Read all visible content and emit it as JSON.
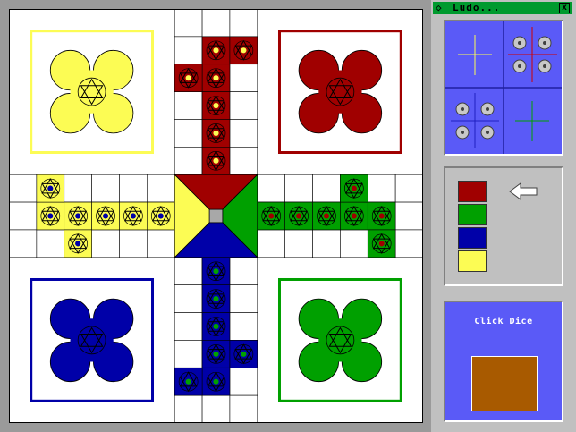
{
  "window": {
    "title": "Ludo...",
    "icon": "diamond-icon",
    "close_label": "x"
  },
  "colors": {
    "red": "#a00000",
    "green": "#00a000",
    "blue": "#0000a8",
    "yellow": "#fcfc54",
    "board_frame": "#9a9a9a",
    "panel_bg": "#c0c0c0",
    "dice_bg": "#5a5af7",
    "dice_face": "#a85a00",
    "center_square": "#a8a8a8"
  },
  "board": {
    "home_bases": [
      {
        "color": "yellow",
        "corner": "top-left"
      },
      {
        "color": "red",
        "corner": "top-right"
      },
      {
        "color": "blue",
        "corner": "bottom-left"
      },
      {
        "color": "green",
        "corner": "bottom-right"
      }
    ],
    "center_triangles": [
      "red",
      "green",
      "blue",
      "yellow"
    ]
  },
  "panel": {
    "dice_legend_icons": [
      "cross-icon",
      "dice-four-icon",
      "dice-four-icon",
      "cross-icon"
    ],
    "player_order": [
      "red",
      "green",
      "blue",
      "yellow"
    ],
    "current_player_index": 0,
    "turn_indicator_icon": "arrow-left-icon",
    "dice_label": "Click Dice"
  }
}
